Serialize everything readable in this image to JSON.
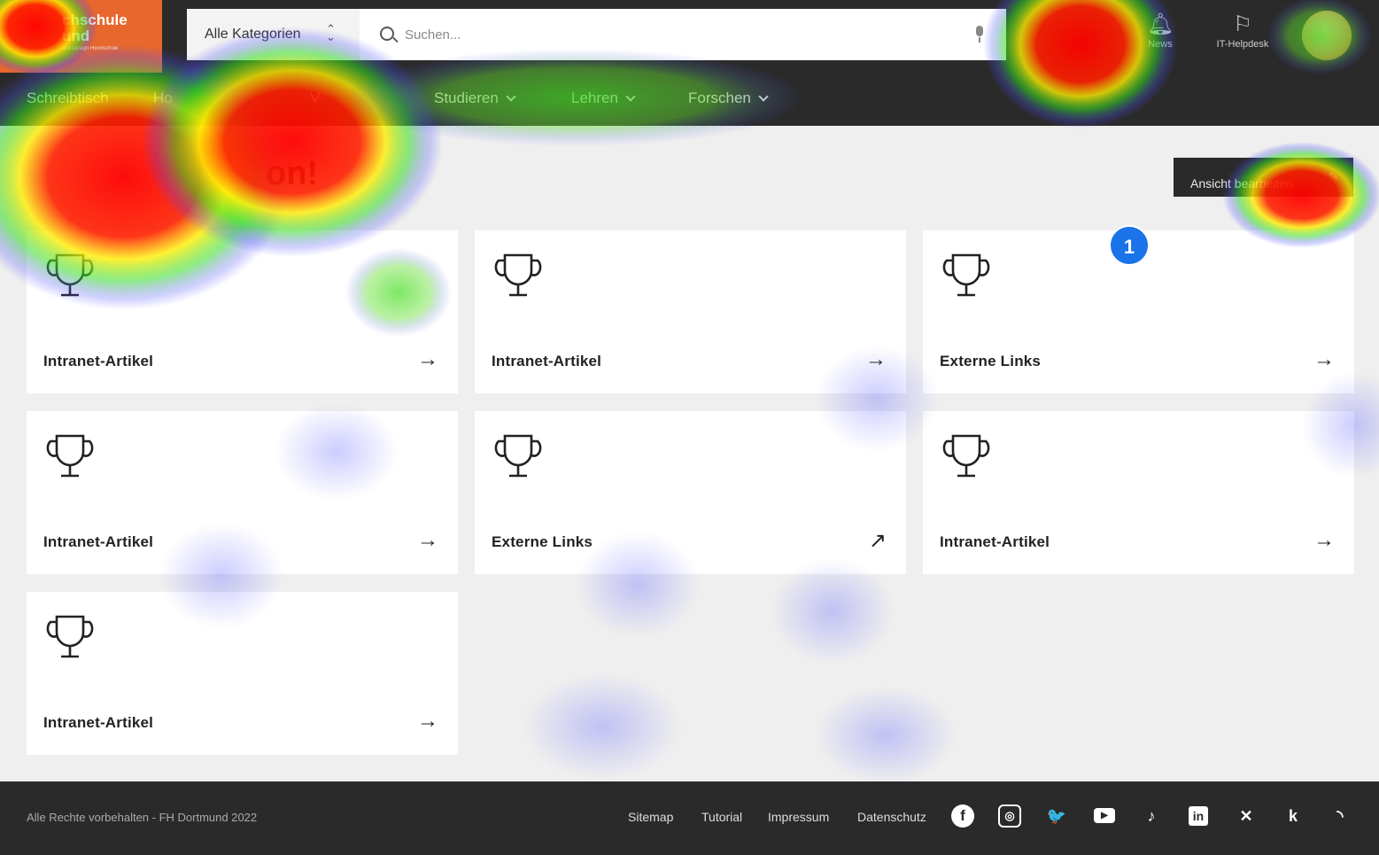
{
  "logo": {
    "line1": "chschule",
    "line2": "und",
    "line3": "und Design Hochschule"
  },
  "search": {
    "category": "Alle Kategorien",
    "placeholder": "Suchen..."
  },
  "header_actions": [
    {
      "label": "News",
      "icon": "bell-icon"
    },
    {
      "label": "IT-Helpdesk",
      "icon": "flag-icon"
    }
  ],
  "nav": [
    {
      "label": "Schreibtisch",
      "has_dropdown": false
    },
    {
      "label": "Ho",
      "has_dropdown": false
    },
    {
      "label": "V",
      "has_dropdown": false
    },
    {
      "label": "Studieren",
      "has_dropdown": true
    },
    {
      "label": "Lehren",
      "has_dropdown": true
    },
    {
      "label": "Forschen",
      "has_dropdown": true
    }
  ],
  "page": {
    "title_fragment": "on!",
    "edit_button": "Ansicht bearbeiten",
    "edit_icon": "pencil-icon"
  },
  "badge": "1",
  "cards": [
    {
      "title": "Intranet-Artikel",
      "arrow": "→"
    },
    {
      "title": "Intranet-Artikel",
      "arrow": "→"
    },
    {
      "title": "Externe Links",
      "arrow": "→"
    },
    {
      "title": "Intranet-Artikel",
      "arrow": "→"
    },
    {
      "title": "Externe Links",
      "arrow": "↗"
    },
    {
      "title": "Intranet-Artikel",
      "arrow": "→"
    },
    {
      "title": "Intranet-Artikel",
      "arrow": "→"
    }
  ],
  "footer": {
    "copyright": "Alle Rechte vorbehalten - FH Dortmund 2022",
    "links": [
      "Sitemap",
      "Tutorial",
      "Impressum",
      "Datenschutz"
    ],
    "social": [
      {
        "name": "facebook-icon",
        "glyph": "f"
      },
      {
        "name": "instagram-icon",
        "glyph": "◎"
      },
      {
        "name": "twitter-icon",
        "glyph": "🐦"
      },
      {
        "name": "youtube-icon",
        "glyph": "▶"
      },
      {
        "name": "tiktok-icon",
        "glyph": "♪"
      },
      {
        "name": "linkedin-icon",
        "glyph": "in"
      },
      {
        "name": "xing-icon",
        "glyph": "✕"
      },
      {
        "name": "kununu-icon",
        "glyph": "k"
      },
      {
        "name": "rss-icon",
        "glyph": "◝"
      }
    ]
  },
  "colors": {
    "brand": "#e8672c",
    "dark": "#2a2a2a",
    "badge": "#1a73e8"
  }
}
